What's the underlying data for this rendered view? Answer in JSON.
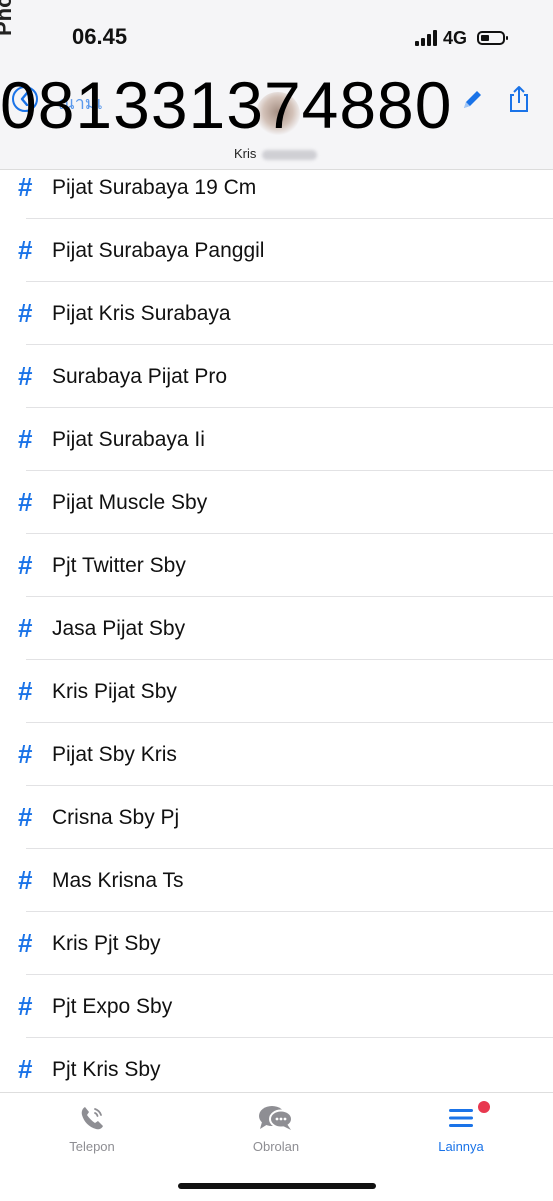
{
  "watermark_side": "Photo",
  "status_bar": {
    "time": "06.45",
    "network": "4G"
  },
  "header": {
    "back_faint_text": "ณามเ",
    "phone_number": "081331374880",
    "contact_name": "Kris"
  },
  "tags": [
    {
      "symbol": "#",
      "label": "Pijat Surabaya 19 Cm"
    },
    {
      "symbol": "#",
      "label": "Pijat Surabaya Panggil"
    },
    {
      "symbol": "#",
      "label": "Pijat Kris Surabaya"
    },
    {
      "symbol": "#",
      "label": "Surabaya Pijat Pro"
    },
    {
      "symbol": "#",
      "label": "Pijat Surabaya Ii"
    },
    {
      "symbol": "#",
      "label": "Pijat Muscle Sby"
    },
    {
      "symbol": "#",
      "label": "Pjt Twitter Sby"
    },
    {
      "symbol": "#",
      "label": "Jasa Pijat Sby"
    },
    {
      "symbol": "#",
      "label": "Kris Pijat Sby"
    },
    {
      "symbol": "#",
      "label": "Pijat Sby Kris"
    },
    {
      "symbol": "#",
      "label": "Crisna Sby Pj"
    },
    {
      "symbol": "#",
      "label": "Mas Krisna Ts"
    },
    {
      "symbol": "#",
      "label": "Kris Pjt Sby"
    },
    {
      "symbol": "#",
      "label": "Pjt Expo Sby"
    },
    {
      "symbol": "#",
      "label": "Pjt Kris Sby"
    }
  ],
  "tabs": [
    {
      "label": "Telepon",
      "icon": "phone-icon"
    },
    {
      "label": "Obrolan",
      "icon": "chat-icon"
    },
    {
      "label": "Lainnya",
      "icon": "menu-icon",
      "active": true
    }
  ],
  "colors": {
    "accent": "#1a73e8",
    "badge": "#e8384f",
    "inactive_tab": "#8e8e93"
  }
}
